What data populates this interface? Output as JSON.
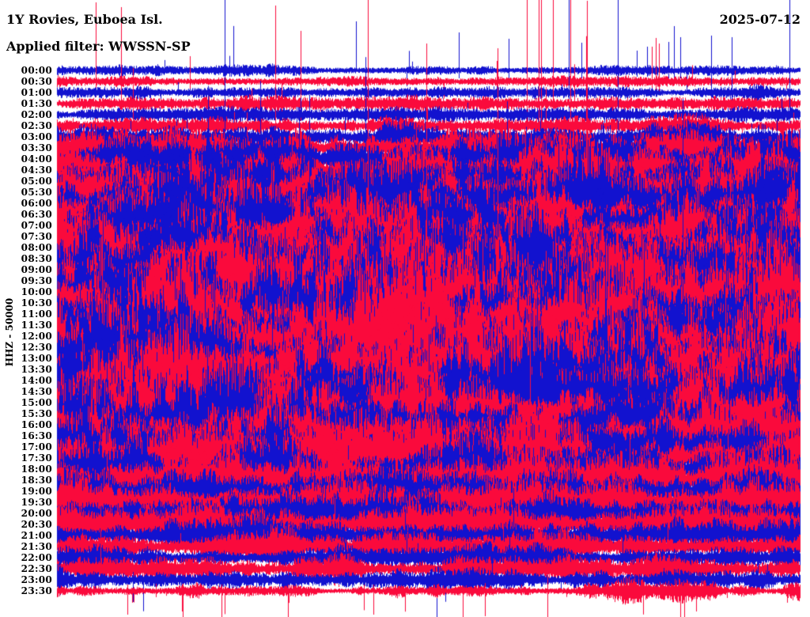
{
  "header": {
    "station_title": "1Y Rovies, Euboea Isl.",
    "filter_label": "Applied filter: WWSSN-SP",
    "date": "2025-07-12",
    "channel_scale_label": "HHZ - 50000"
  },
  "chart_data": {
    "type": "line",
    "variant": "helicorder-seismogram",
    "network": "1Y",
    "station": "Rovies, Euboea Isl.",
    "channel": "HHZ",
    "amplitude_scale": 50000,
    "applied_filter": "WWSSN-SP",
    "date": "2025-07-12",
    "minutes_per_row": 30,
    "time_axis_start": "00:00",
    "time_axis_end": "23:30",
    "legend_position": "none",
    "grid": false,
    "trace_colors": {
      "even_rows": "#1212cf",
      "odd_rows": "#fa0a3c"
    },
    "rows": [
      {
        "label": "00:00",
        "color": "blue",
        "amp": 4,
        "var": 0.5,
        "spike_p": 0.006
      },
      {
        "label": "00:30",
        "color": "red",
        "amp": 4,
        "var": 0.5,
        "spike_p": 0.006
      },
      {
        "label": "01:00",
        "color": "blue",
        "amp": 4.5,
        "var": 0.55,
        "spike_p": 0.006
      },
      {
        "label": "01:30",
        "color": "red",
        "amp": 5,
        "var": 0.6,
        "spike_p": 0.006
      },
      {
        "label": "02:00",
        "color": "blue",
        "amp": 5,
        "var": 0.6,
        "spike_p": 0.006
      },
      {
        "label": "02:30",
        "color": "red",
        "amp": 7,
        "var": 0.7,
        "spike_p": 0.007
      },
      {
        "label": "03:00",
        "color": "blue",
        "amp": 10,
        "var": 0.75,
        "spike_p": 0.006
      },
      {
        "label": "03:30",
        "color": "red",
        "amp": 13,
        "var": 0.8,
        "spike_p": 0.006
      },
      {
        "label": "04:00",
        "color": "blue",
        "amp": 16,
        "var": 0.9,
        "spike_p": 0.005
      },
      {
        "label": "04:30",
        "color": "red",
        "amp": 19,
        "var": 0.95,
        "spike_p": 0.005
      },
      {
        "label": "05:00",
        "color": "blue",
        "amp": 21,
        "var": 1,
        "spike_p": 0.004
      },
      {
        "label": "05:30",
        "color": "red",
        "amp": 23,
        "var": 1,
        "spike_p": 0.004
      },
      {
        "label": "06:00",
        "color": "blue",
        "amp": 25,
        "var": 1,
        "spike_p": 0.004
      },
      {
        "label": "06:30",
        "color": "red",
        "amp": 26,
        "var": 1,
        "spike_p": 0.004
      },
      {
        "label": "07:00",
        "color": "blue",
        "amp": 26,
        "var": 1,
        "spike_p": 0.004
      },
      {
        "label": "07:30",
        "color": "red",
        "amp": 27,
        "var": 1,
        "spike_p": 0.004
      },
      {
        "label": "08:00",
        "color": "blue",
        "amp": 27,
        "var": 1,
        "spike_p": 0.004
      },
      {
        "label": "08:30",
        "color": "red",
        "amp": 28,
        "var": 1,
        "spike_p": 0.004
      },
      {
        "label": "09:00",
        "color": "blue",
        "amp": 28,
        "var": 1,
        "spike_p": 0.004
      },
      {
        "label": "09:30",
        "color": "red",
        "amp": 28,
        "var": 1,
        "spike_p": 0.004
      },
      {
        "label": "10:00",
        "color": "blue",
        "amp": 29,
        "var": 1,
        "spike_p": 0.004
      },
      {
        "label": "10:30",
        "color": "red",
        "amp": 29,
        "var": 1,
        "spike_p": 0.004
      },
      {
        "label": "11:00",
        "color": "blue",
        "amp": 29,
        "var": 1,
        "spike_p": 0.004
      },
      {
        "label": "11:30",
        "color": "red",
        "amp": 30,
        "var": 1,
        "spike_p": 0.004
      },
      {
        "label": "12:00",
        "color": "blue",
        "amp": 30,
        "var": 1,
        "spike_p": 0.004
      },
      {
        "label": "12:30",
        "color": "red",
        "amp": 30,
        "var": 1,
        "spike_p": 0.004
      },
      {
        "label": "13:00",
        "color": "blue",
        "amp": 29,
        "var": 1,
        "spike_p": 0.004
      },
      {
        "label": "13:30",
        "color": "red",
        "amp": 30,
        "var": 1,
        "spike_p": 0.004
      },
      {
        "label": "14:00",
        "color": "blue",
        "amp": 30,
        "var": 1,
        "spike_p": 0.004
      },
      {
        "label": "14:30",
        "color": "red",
        "amp": 29,
        "var": 1,
        "spike_p": 0.004
      },
      {
        "label": "15:00",
        "color": "blue",
        "amp": 30,
        "var": 1,
        "spike_p": 0.004
      },
      {
        "label": "15:30",
        "color": "red",
        "amp": 30,
        "var": 1,
        "spike_p": 0.004
      },
      {
        "label": "16:00",
        "color": "blue",
        "amp": 29,
        "var": 1,
        "spike_p": 0.004
      },
      {
        "label": "16:30",
        "color": "red",
        "amp": 28,
        "var": 1,
        "spike_p": 0.004
      },
      {
        "label": "17:00",
        "color": "blue",
        "amp": 26,
        "var": 1,
        "spike_p": 0.004
      },
      {
        "label": "17:30",
        "color": "red",
        "amp": 24,
        "var": 0.95,
        "spike_p": 0.004
      },
      {
        "label": "18:00",
        "color": "blue",
        "amp": 20,
        "var": 0.85,
        "spike_p": 0.004
      },
      {
        "label": "18:30",
        "color": "red",
        "amp": 17,
        "var": 0.8,
        "spike_p": 0.005
      },
      {
        "label": "19:00",
        "color": "blue",
        "amp": 16,
        "var": 0.75,
        "spike_p": 0.005
      },
      {
        "label": "19:30",
        "color": "red",
        "amp": 15,
        "var": 0.7,
        "spike_p": 0.005
      },
      {
        "label": "20:00",
        "color": "blue",
        "amp": 15,
        "var": 0.7,
        "spike_p": 0.005
      },
      {
        "label": "20:30",
        "color": "red",
        "amp": 14,
        "var": 0.7,
        "spike_p": 0.005
      },
      {
        "label": "21:00",
        "color": "blue",
        "amp": 13,
        "var": 0.7,
        "spike_p": 0.006
      },
      {
        "label": "21:30",
        "color": "red",
        "amp": 12,
        "var": 0.7,
        "spike_p": 0.006
      },
      {
        "label": "22:00",
        "color": "blue",
        "amp": 9,
        "var": 0.75,
        "spike_p": 0.008
      },
      {
        "label": "22:30",
        "color": "red",
        "amp": 8,
        "var": 0.75,
        "spike_p": 0.008
      },
      {
        "label": "23:00",
        "color": "blue",
        "amp": 8,
        "var": 0.75,
        "spike_p": 0.008
      },
      {
        "label": "23:30",
        "color": "red",
        "amp": 6,
        "var": 0.8,
        "spike_p": 0.01
      }
    ],
    "events": [
      {
        "row": 1,
        "x": 0.052,
        "up": 100,
        "down": 20
      },
      {
        "row": 3,
        "x": 0.086,
        "up": 122,
        "down": 25
      },
      {
        "row": 1,
        "x": 0.179,
        "up": 32,
        "down": 12
      },
      {
        "row": 5,
        "x": 0.294,
        "up": 152,
        "down": 25
      },
      {
        "row": 3,
        "x": 0.328,
        "up": 92,
        "down": 22
      },
      {
        "row": 0,
        "x": 0.54,
        "up": 48,
        "down": 10
      },
      {
        "row": 1,
        "x": 0.592,
        "up": 26,
        "down": 10
      },
      {
        "row": 0,
        "x": 0.607,
        "up": 40,
        "down": 10
      },
      {
        "row": 3,
        "x": 0.632,
        "up": 150,
        "down": 28
      },
      {
        "row": 5,
        "x": 0.648,
        "up": 172,
        "down": 30
      },
      {
        "row": 5,
        "x": 0.651,
        "up": 170,
        "down": 30
      },
      {
        "row": 3,
        "x": 0.667,
        "up": 146,
        "down": 28
      },
      {
        "row": 2,
        "x": 0.688,
        "up": 120,
        "down": 20
      },
      {
        "row": 0,
        "x": 0.705,
        "up": 35,
        "down": 10
      },
      {
        "row": 7,
        "x": 0.69,
        "up": 190,
        "down": 30
      },
      {
        "row": 7,
        "x": 0.713,
        "up": 186,
        "down": 30
      },
      {
        "row": 0,
        "x": 0.78,
        "up": 25,
        "down": 8
      },
      {
        "row": 0,
        "x": 0.794,
        "up": 30,
        "down": 8
      },
      {
        "row": 1,
        "x": 0.8,
        "up": 44,
        "down": 14
      },
      {
        "row": 1,
        "x": 0.805,
        "up": 55,
        "down": 14
      },
      {
        "row": 1,
        "x": 0.81,
        "up": 48,
        "down": 14
      },
      {
        "row": 0,
        "x": 0.822,
        "up": 36,
        "down": 10
      },
      {
        "row": 0,
        "x": 0.83,
        "up": 56,
        "down": 12
      },
      {
        "row": 0,
        "x": 0.838,
        "up": 42,
        "down": 10
      },
      {
        "row": 2,
        "x": 0.88,
        "up": 72,
        "down": 15
      },
      {
        "row": 2,
        "x": 0.907,
        "up": 70,
        "down": 15
      },
      {
        "row": 4,
        "x": 0.985,
        "up": 150,
        "down": 22
      },
      {
        "row": 47,
        "x": 0.095,
        "up": 8,
        "down": 30
      },
      {
        "row": 46,
        "x": 0.102,
        "up": 10,
        "down": 28
      },
      {
        "row": 47,
        "x": 0.168,
        "up": 8,
        "down": 26
      },
      {
        "row": 47,
        "x": 0.425,
        "up": 8,
        "down": 30
      },
      {
        "row": 47,
        "x": 0.575,
        "up": 10,
        "down": 32
      },
      {
        "row": 47,
        "x": 0.66,
        "up": 26,
        "down": 33
      },
      {
        "row": 47,
        "x": 0.86,
        "up": 8,
        "down": 26
      }
    ]
  }
}
